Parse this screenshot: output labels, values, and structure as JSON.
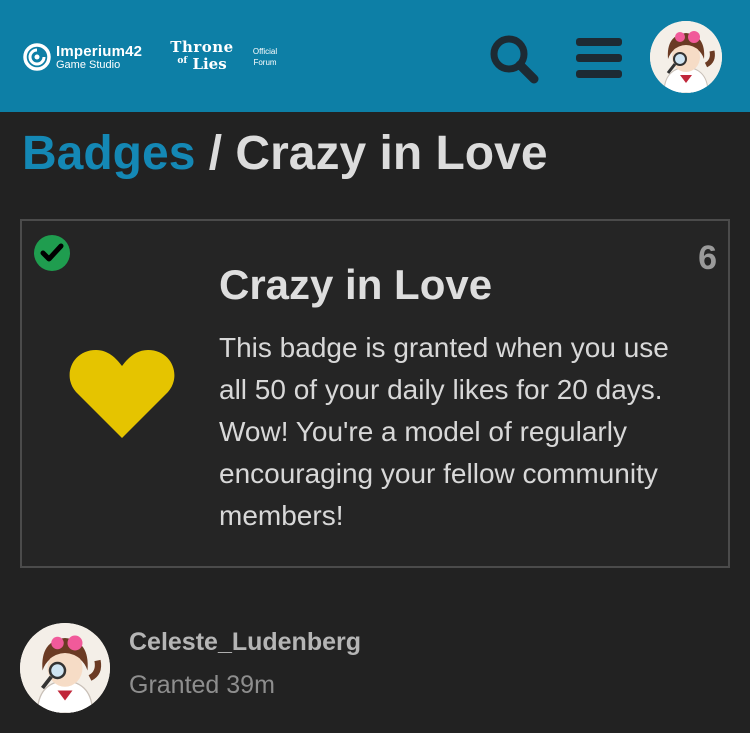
{
  "header": {
    "brand": {
      "name": "Imperium42",
      "subtitle": "Game Studio"
    },
    "game": {
      "line1": "Throne",
      "of": "of",
      "line2": "Lies"
    },
    "forum_tag": {
      "line1": "Official",
      "line2": "Forum"
    },
    "icons": {
      "search": "search-icon",
      "menu": "hamburger-menu-icon",
      "avatar": "user-avatar"
    },
    "colors": {
      "background": "#0d7fa6"
    }
  },
  "breadcrumb": {
    "parent": "Badges",
    "separator": "/",
    "current": "Crazy in Love"
  },
  "badge": {
    "title": "Crazy in Love",
    "count": "6",
    "description": "This badge is granted when you use all 50 of your daily likes for 20 days. Wow! You're a model of regularly encouraging your fellow community members!",
    "icon": "heart-icon",
    "granted_icon": "check-circle-icon",
    "colors": {
      "heart": "#e5c400",
      "check": "#1f9d4f"
    }
  },
  "granted_user": {
    "username": "Celeste_Ludenberg",
    "granted_label": "Granted 39m"
  }
}
